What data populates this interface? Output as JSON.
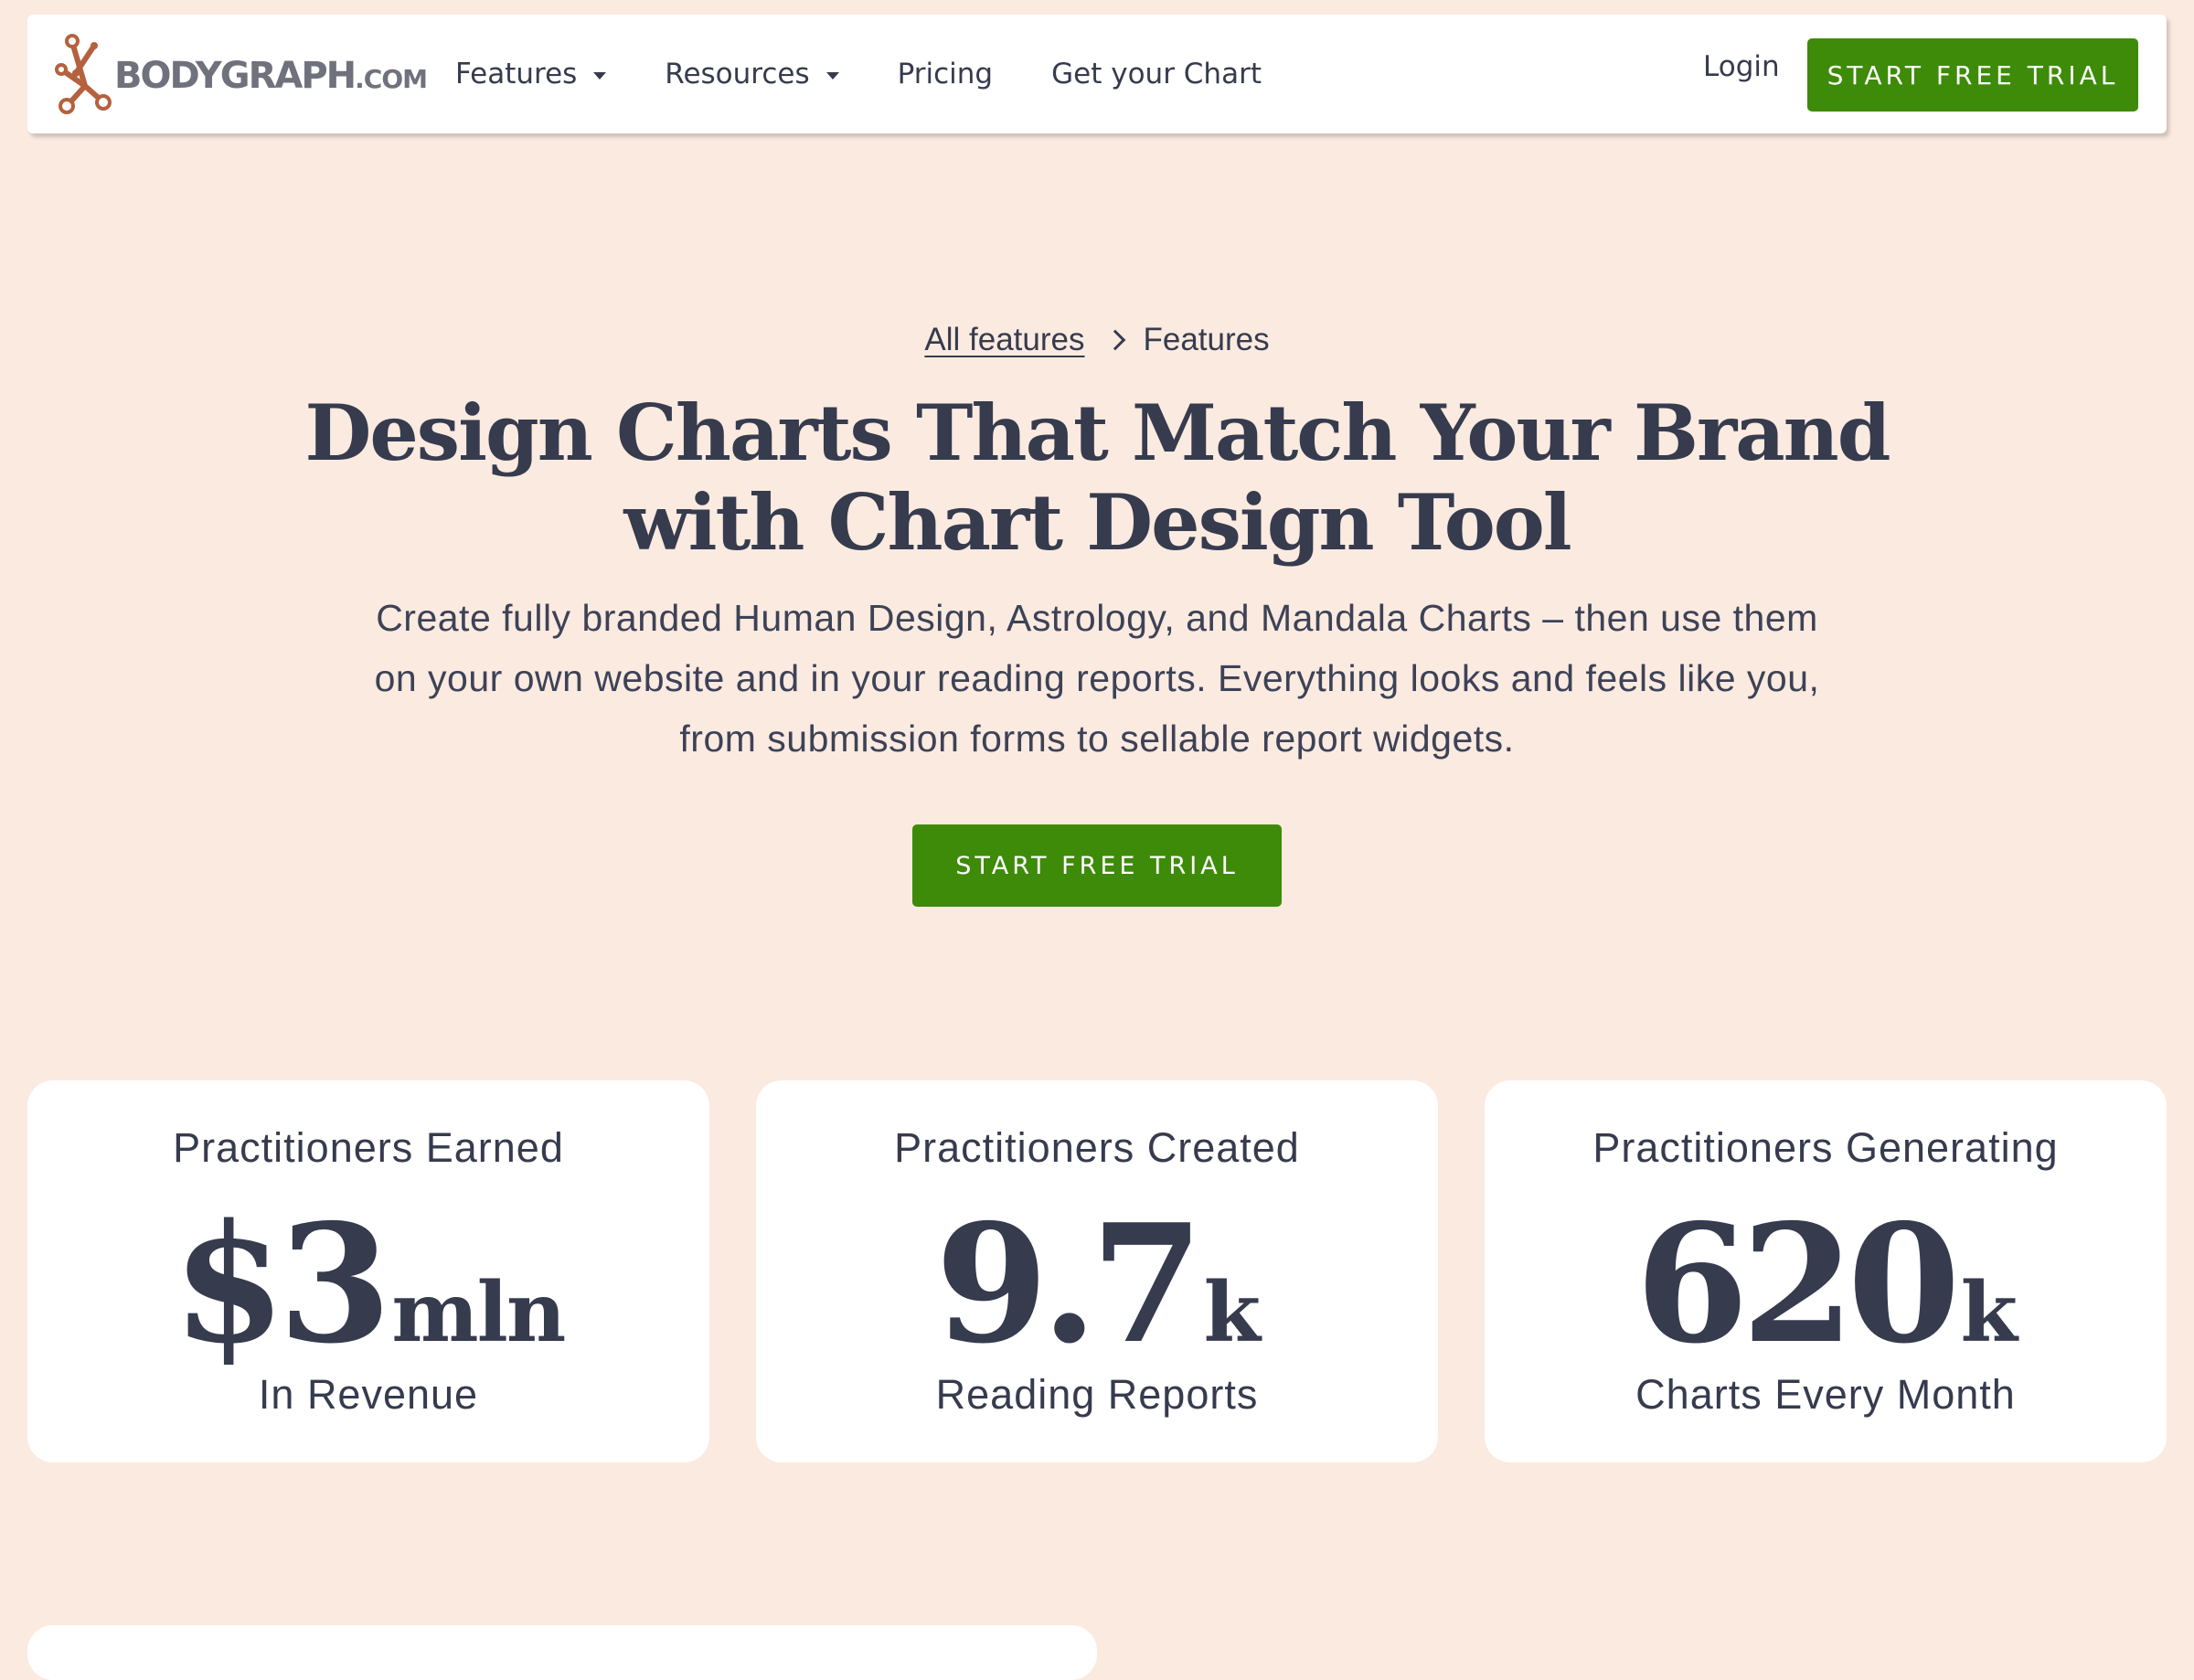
{
  "nav": {
    "logo_text": "BODYGRAPH",
    "logo_suffix": ".COM",
    "menu": [
      {
        "label": "Features",
        "has_dropdown": true
      },
      {
        "label": "Resources",
        "has_dropdown": true
      },
      {
        "label": "Pricing",
        "has_dropdown": false
      },
      {
        "label": "Get your Chart",
        "has_dropdown": false
      }
    ],
    "login_label": "Login",
    "cta_label": "START FREE TRIAL"
  },
  "breadcrumb": {
    "parent": "All features",
    "current": "Features"
  },
  "hero": {
    "title_line1": "Design Charts That Match Your Brand",
    "title_line2": "with Chart Design Tool",
    "subtitle": "Create fully branded Human Design, Astrology, and Mandala Charts – then use them on your own website and in your reading reports. Everything looks and feels like you, from submission forms to sellable report widgets.",
    "cta_label": "START FREE TRIAL"
  },
  "stats": [
    {
      "label": "Practitioners Earned",
      "value": "$3",
      "unit": "mln",
      "caption": "In Revenue"
    },
    {
      "label": "Practitioners Created",
      "value": "9.7",
      "unit": "k",
      "caption": "Reading Reports"
    },
    {
      "label": "Practitioners Generating",
      "value": "620",
      "unit": "k",
      "caption": "Charts Every Month"
    }
  ],
  "colors": {
    "page_background": "#fbeae0",
    "accent_green": "#3d8b08",
    "text_dark": "#363b4e",
    "logo_mark": "#b5613e",
    "logo_text": "#6f717c"
  },
  "icons": {
    "logo": "bodygraph-logo-mark",
    "dropdown": "caret-down-icon",
    "breadcrumb_separator": "chevron-right-icon"
  }
}
